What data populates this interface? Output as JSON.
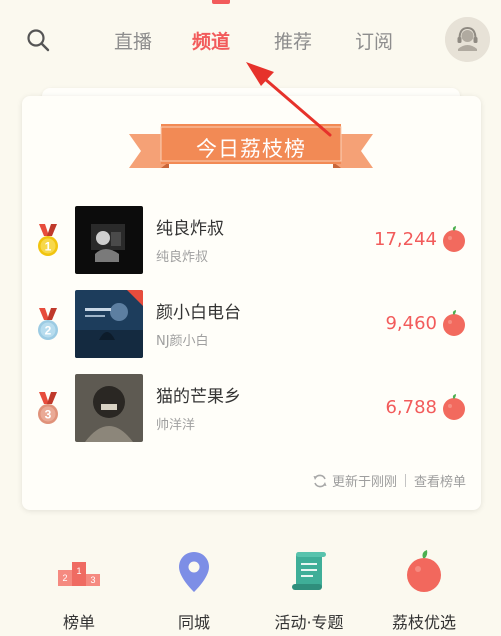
{
  "header": {
    "tabs": [
      {
        "label": "直播",
        "active": false
      },
      {
        "label": "频道",
        "active": true
      },
      {
        "label": "推荐",
        "active": false
      },
      {
        "label": "订阅",
        "active": false
      }
    ],
    "icons": {
      "search": "search-icon",
      "avatar": "user-avatar-icon"
    }
  },
  "ranking_card": {
    "title": "今日荔枝榜",
    "items": [
      {
        "rank": "1",
        "name": "纯良炸叔",
        "host": "纯良炸叔",
        "count": "17,244",
        "medal": "gold"
      },
      {
        "rank": "2",
        "name": "颜小白电台",
        "host": "NJ颜小白",
        "count": "9,460",
        "medal": "silver"
      },
      {
        "rank": "3",
        "name": "猫的芒果乡",
        "host": "帅洋洋",
        "count": "6,788",
        "medal": "bronze"
      }
    ],
    "updated_text": "更新于刚刚",
    "view_chart_label": "查看榜单"
  },
  "bottom_nav": [
    {
      "label": "榜单",
      "icon": "podium-icon"
    },
    {
      "label": "同城",
      "icon": "location-pin-icon"
    },
    {
      "label": "活动·专题",
      "icon": "scroll-icon"
    },
    {
      "label": "荔枝优选",
      "icon": "lychee-icon"
    }
  ],
  "colors": {
    "accent": "#f25b5b",
    "ribbon": "#f28a55",
    "background": "#fbf9ef",
    "medal_gold": "#f1c40f",
    "medal_silver": "#9ccbe3",
    "medal_bronze": "#e0927a"
  }
}
